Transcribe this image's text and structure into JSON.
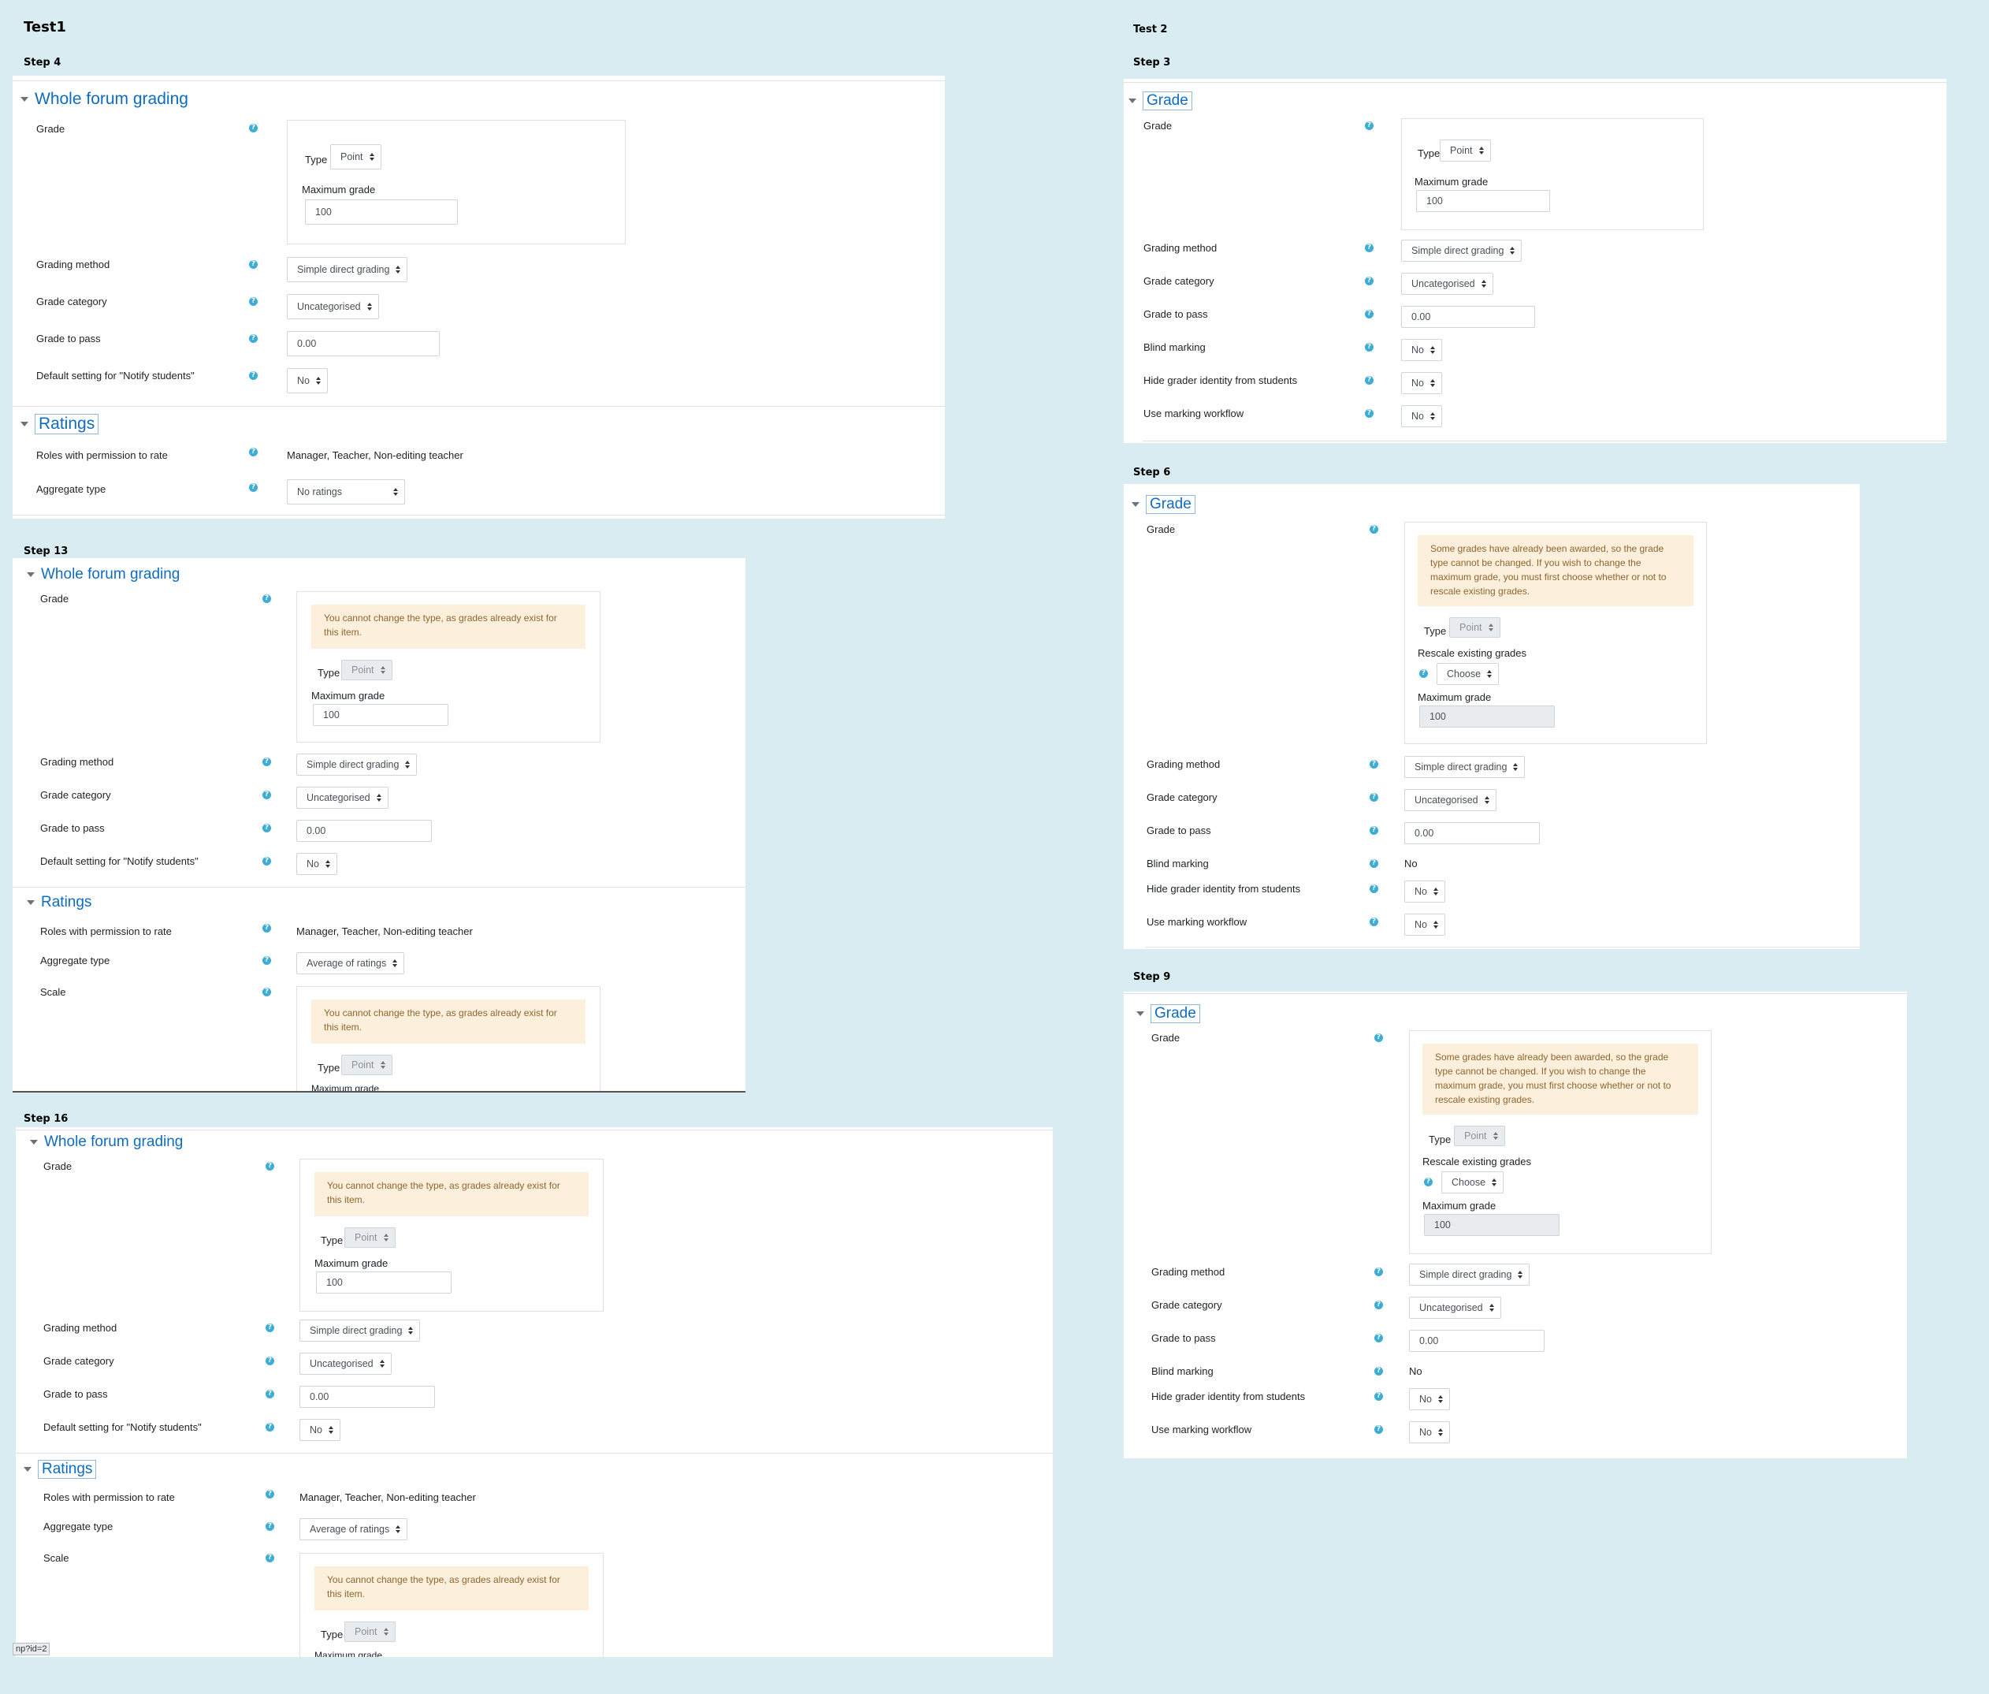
{
  "test1": {
    "title": "Test1"
  },
  "test2": {
    "title": "Test 2"
  },
  "steps": {
    "s4": "Step 4",
    "s13": "Step 13",
    "s16": "Step 16",
    "s3": "Step 3",
    "s6": "Step 6",
    "s9": "Step 9"
  },
  "headings": {
    "whole_forum_grading": "Whole forum grading",
    "ratings": "Ratings",
    "grade": "Grade"
  },
  "labels": {
    "grade": "Grade",
    "type": "Type",
    "maximum_grade": "Maximum grade",
    "grading_method": "Grading method",
    "grade_category": "Grade category",
    "grade_to_pass": "Grade to pass",
    "notify_students": "Default setting for \"Notify students\"",
    "roles_permission": "Roles with permission to rate",
    "aggregate_type": "Aggregate type",
    "scale": "Scale",
    "blind_marking": "Blind marking",
    "hide_grader": "Hide grader identity from students",
    "use_marking_workflow": "Use marking workflow",
    "rescale_existing": "Rescale existing grades"
  },
  "values": {
    "type_point": "Point",
    "max_grade": "100",
    "grading_method": "Simple direct grading",
    "grade_category": "Uncategorised",
    "grade_to_pass": "0.00",
    "no": "No",
    "no_ratings": "No ratings",
    "average_of_ratings": "Average of ratings",
    "roles": "Manager, Teacher, Non-editing teacher",
    "choose": "Choose",
    "max_grade_cut": "Maximum grade"
  },
  "alerts": {
    "cannot_change_type": "You cannot change the type, as grades already exist for this item.",
    "grades_awarded": "Some grades have already been awarded, so the grade type cannot be changed. If you wish to change the maximum grade, you must first choose whether or not to rescale existing grades."
  },
  "icons": {
    "help": "help-icon",
    "collapse": "caret-down-icon"
  },
  "status_url": "np?id=2"
}
